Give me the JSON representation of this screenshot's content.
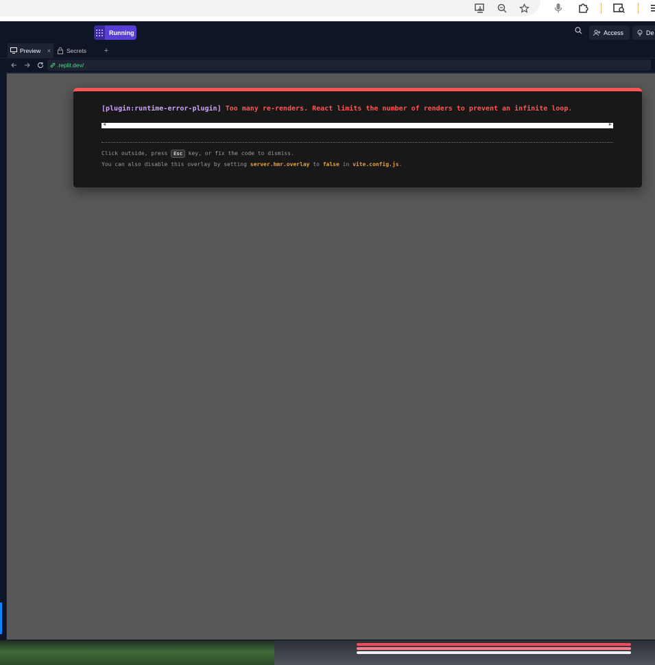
{
  "browser": {
    "icons": [
      "install-app-icon",
      "zoom-icon",
      "bookmark-star-icon",
      "microphone-icon",
      "extensions-icon",
      "search-tab-icon",
      "menu-icon"
    ]
  },
  "topbar": {
    "run_label": "Running",
    "access_label": "Access",
    "deploy_label": "De"
  },
  "tabs": [
    {
      "label": "Preview",
      "active": true,
      "closable": true
    },
    {
      "label": "Secrets",
      "active": false,
      "closable": false
    }
  ],
  "address": {
    "url": ".replit.dev/"
  },
  "error": {
    "plugin": "[plugin:runtime-error-plugin]",
    "message": "Too many re-renders. React limits the number of renders to prevent an infinite loop.",
    "tip1_before": "Click outside, press ",
    "tip1_key": "Esc",
    "tip1_after": " key, or fix the code to dismiss.",
    "tip2_part1": "You can also disable this overlay by setting ",
    "tip2_code1": "server.hmr.overlay",
    "tip2_part2": " to ",
    "tip2_code2": "false",
    "tip2_part3": " in ",
    "tip2_code3": "vite.config.js",
    "tip2_part4": "."
  },
  "colors": {
    "error_red": "#ff5555",
    "plugin_purple": "#cfa3ff",
    "code_yellow": "#e8a33d",
    "run_purple": "#5a3fd6",
    "url_green": "#5bd48b"
  }
}
